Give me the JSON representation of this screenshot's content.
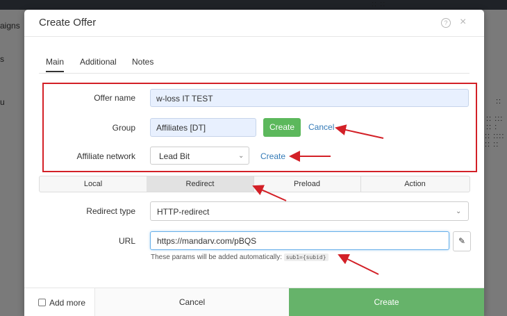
{
  "background": {
    "sidebar_fragments": [
      "aigns",
      "s",
      "u"
    ],
    "right_fragments": [
      ":: ::",
      "::",
      ":: ::: :: :",
      ":: :::: :: ::"
    ]
  },
  "modal": {
    "title": "Create Offer",
    "help_icon": "question-circle-icon",
    "close_icon": "close-icon"
  },
  "tabs": [
    "Main",
    "Additional",
    "Notes"
  ],
  "form": {
    "offer_name_label": "Offer name",
    "offer_name_value": "w-loss IT TEST",
    "group_label": "Group",
    "group_value": "Affiliates [DT]",
    "group_create": "Create",
    "group_cancel": "Cancel",
    "network_label": "Affiliate network",
    "network_value": "Lead Bit",
    "network_create": "Create"
  },
  "mode_tabs": [
    "Local",
    "Redirect",
    "Preload",
    "Action"
  ],
  "redirect": {
    "type_label": "Redirect type",
    "type_value": "HTTP-redirect",
    "url_label": "URL",
    "url_value": "https://mandarv.com/pBQS",
    "help_text": "These params will be added automatically:",
    "help_code": "sub1={subid}"
  },
  "footer": {
    "add_more": "Add more",
    "cancel": "Cancel",
    "create": "Create"
  },
  "colors": {
    "highlight": "#d32027",
    "green": "#5cb85c",
    "link": "#337ab7"
  }
}
